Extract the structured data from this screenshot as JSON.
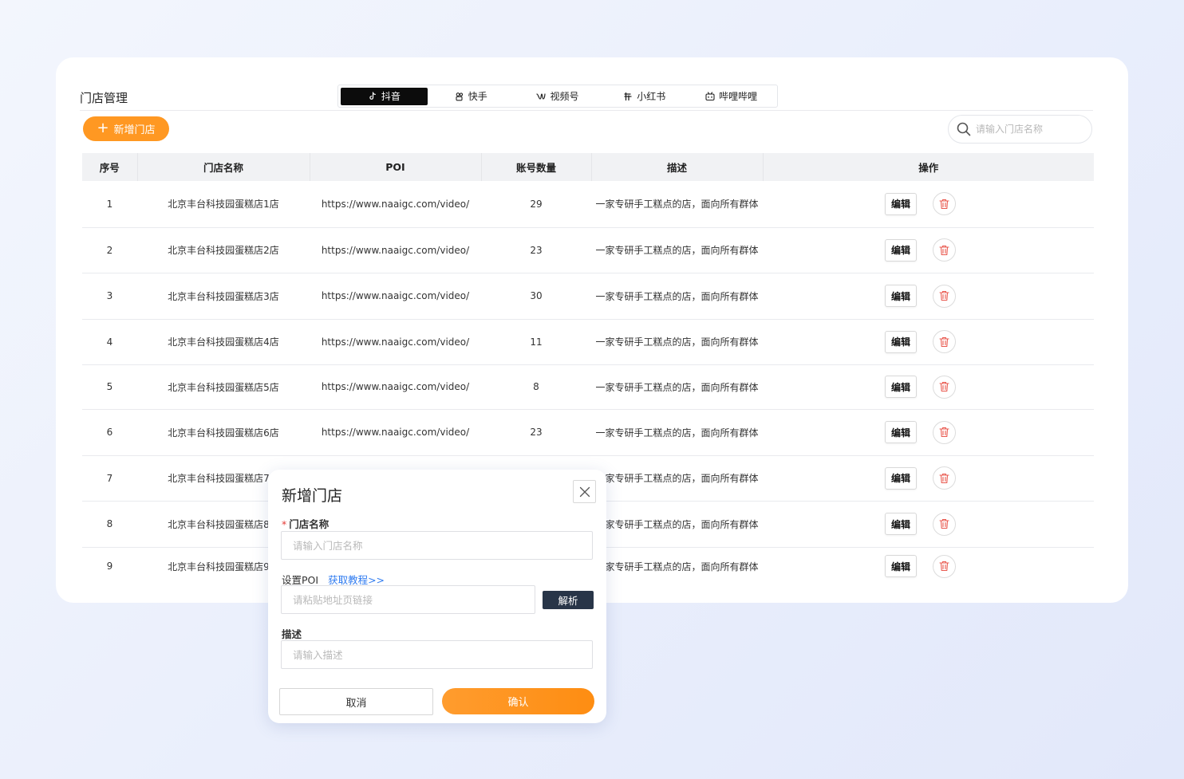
{
  "page": {
    "title": "门店管理",
    "add_button": "新增门店",
    "search_placeholder": "请输入门店名称"
  },
  "tabs": [
    {
      "label": "抖音",
      "icon": "douyin-icon",
      "active": true
    },
    {
      "label": "快手",
      "icon": "kuaishou-icon",
      "active": false
    },
    {
      "label": "视频号",
      "icon": "channels-icon",
      "active": false
    },
    {
      "label": "小红书",
      "icon": "xiaohongshu-icon",
      "active": false
    },
    {
      "label": "哔哩哔哩",
      "icon": "bilibili-icon",
      "active": false
    }
  ],
  "table": {
    "columns": [
      "序号",
      "门店名称",
      "POI",
      "账号数量",
      "描述",
      "操作"
    ],
    "edit_label": "编辑",
    "rows": [
      {
        "no": "1",
        "name": "北京丰台科技园蛋糕店1店",
        "poi": "https://www.naaigc.com/video/",
        "count": "29",
        "desc": "一家专研手工糕点的店，面向所有群体"
      },
      {
        "no": "2",
        "name": "北京丰台科技园蛋糕店2店",
        "poi": "https://www.naaigc.com/video/",
        "count": "23",
        "desc": "一家专研手工糕点的店，面向所有群体"
      },
      {
        "no": "3",
        "name": "北京丰台科技园蛋糕店3店",
        "poi": "https://www.naaigc.com/video/",
        "count": "30",
        "desc": "一家专研手工糕点的店，面向所有群体"
      },
      {
        "no": "4",
        "name": "北京丰台科技园蛋糕店4店",
        "poi": "https://www.naaigc.com/video/",
        "count": "11",
        "desc": "一家专研手工糕点的店，面向所有群体"
      },
      {
        "no": "5",
        "name": "北京丰台科技园蛋糕店5店",
        "poi": "https://www.naaigc.com/video/",
        "count": "8",
        "desc": "一家专研手工糕点的店，面向所有群体"
      },
      {
        "no": "6",
        "name": "北京丰台科技园蛋糕店6店",
        "poi": "https://www.naaigc.com/video/",
        "count": "23",
        "desc": "一家专研手工糕点的店，面向所有群体"
      },
      {
        "no": "7",
        "name": "北京丰台科技园蛋糕店7店",
        "poi": "",
        "count": "",
        "desc": "一家专研手工糕点的店，面向所有群体"
      },
      {
        "no": "8",
        "name": "北京丰台科技园蛋糕店8店",
        "poi": "",
        "count": "",
        "desc": "一家专研手工糕点的店，面向所有群体"
      },
      {
        "no": "9",
        "name": "北京丰台科技园蛋糕店9店",
        "poi": "",
        "count": "",
        "desc": "一家专研手工糕点的店，面向所有群体"
      }
    ]
  },
  "modal": {
    "title": "新增门店",
    "name_label": "门店名称",
    "name_placeholder": "请输入门店名称",
    "poi_label": "设置POI",
    "poi_link": "获取教程>>",
    "poi_placeholder": "请粘贴地址页链接",
    "parse_button": "解析",
    "desc_label": "描述",
    "desc_placeholder": "请输入描述",
    "cancel": "取消",
    "confirm": "确认"
  },
  "colors": {
    "accent_orange": "#ff9822",
    "delete_red": "#e9594f",
    "link_blue": "#2f7bf0",
    "dark_button": "#283548"
  }
}
